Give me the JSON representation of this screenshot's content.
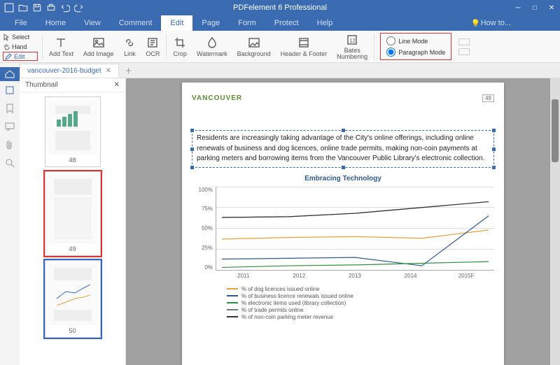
{
  "app": {
    "title": "PDFelement 6 Professional"
  },
  "menu": {
    "tabs": [
      "File",
      "Home",
      "View",
      "Comment",
      "Edit",
      "Page",
      "Form",
      "Protect",
      "Help"
    ],
    "active": 4,
    "howto": "How to..."
  },
  "side_tools": {
    "select": "Select",
    "hand": "Hand",
    "edit": "Edit"
  },
  "ribbon": {
    "add_text": "Add Text",
    "add_image": "Add Image",
    "link": "Link",
    "ocr": "OCR",
    "crop": "Crop",
    "watermark": "Watermark",
    "background": "Background",
    "header_footer": "Header & Footer",
    "bates": "Bates\nNumbering"
  },
  "modes": {
    "line": "Line Mode",
    "paragraph": "Paragraph Mode",
    "selected": "paragraph"
  },
  "doc": {
    "tab_name": "vancouver-2016-budget"
  },
  "thumbnail": {
    "title": "Thumbnail",
    "pages": [
      48,
      49,
      50
    ]
  },
  "page": {
    "brand": "VANCOUVER",
    "number": "49",
    "paragraph": "Residents are increasingly taking advantage of the City's online offerings, including online renewals of business and dog licences, online trade permits, making non-coin payments at parking meters and borrowing items from the Vancouver Public Library's electronic collection."
  },
  "chart_data": {
    "type": "line",
    "title": "Embracing Technology",
    "xlabel": "",
    "ylabel": "",
    "categories": [
      "2011",
      "2012",
      "2013",
      "2014",
      "2015F"
    ],
    "yticks": [
      "0%",
      "25%",
      "50%",
      "75%",
      "100%"
    ],
    "ylim": [
      0,
      100
    ],
    "series": [
      {
        "name": "% of dog licences issued online",
        "color": "#e8a23a",
        "values": [
          37,
          39,
          40,
          38,
          48
        ]
      },
      {
        "name": "% of business licence renewals issued online",
        "color": "#2b5a8f",
        "values": [
          13,
          14,
          15,
          5,
          65
        ]
      },
      {
        "name": "% electronic items used (library collection)",
        "color": "#2e8f3c",
        "values": [
          3,
          5,
          6,
          8,
          10
        ]
      },
      {
        "name": "% of trade permits online",
        "color": "#777",
        "values": [
          63,
          64,
          68,
          75,
          82
        ]
      },
      {
        "name": "% of non-coin parking meter revenue",
        "color": "#333",
        "values": [
          63,
          64,
          68,
          75,
          82
        ]
      }
    ]
  }
}
